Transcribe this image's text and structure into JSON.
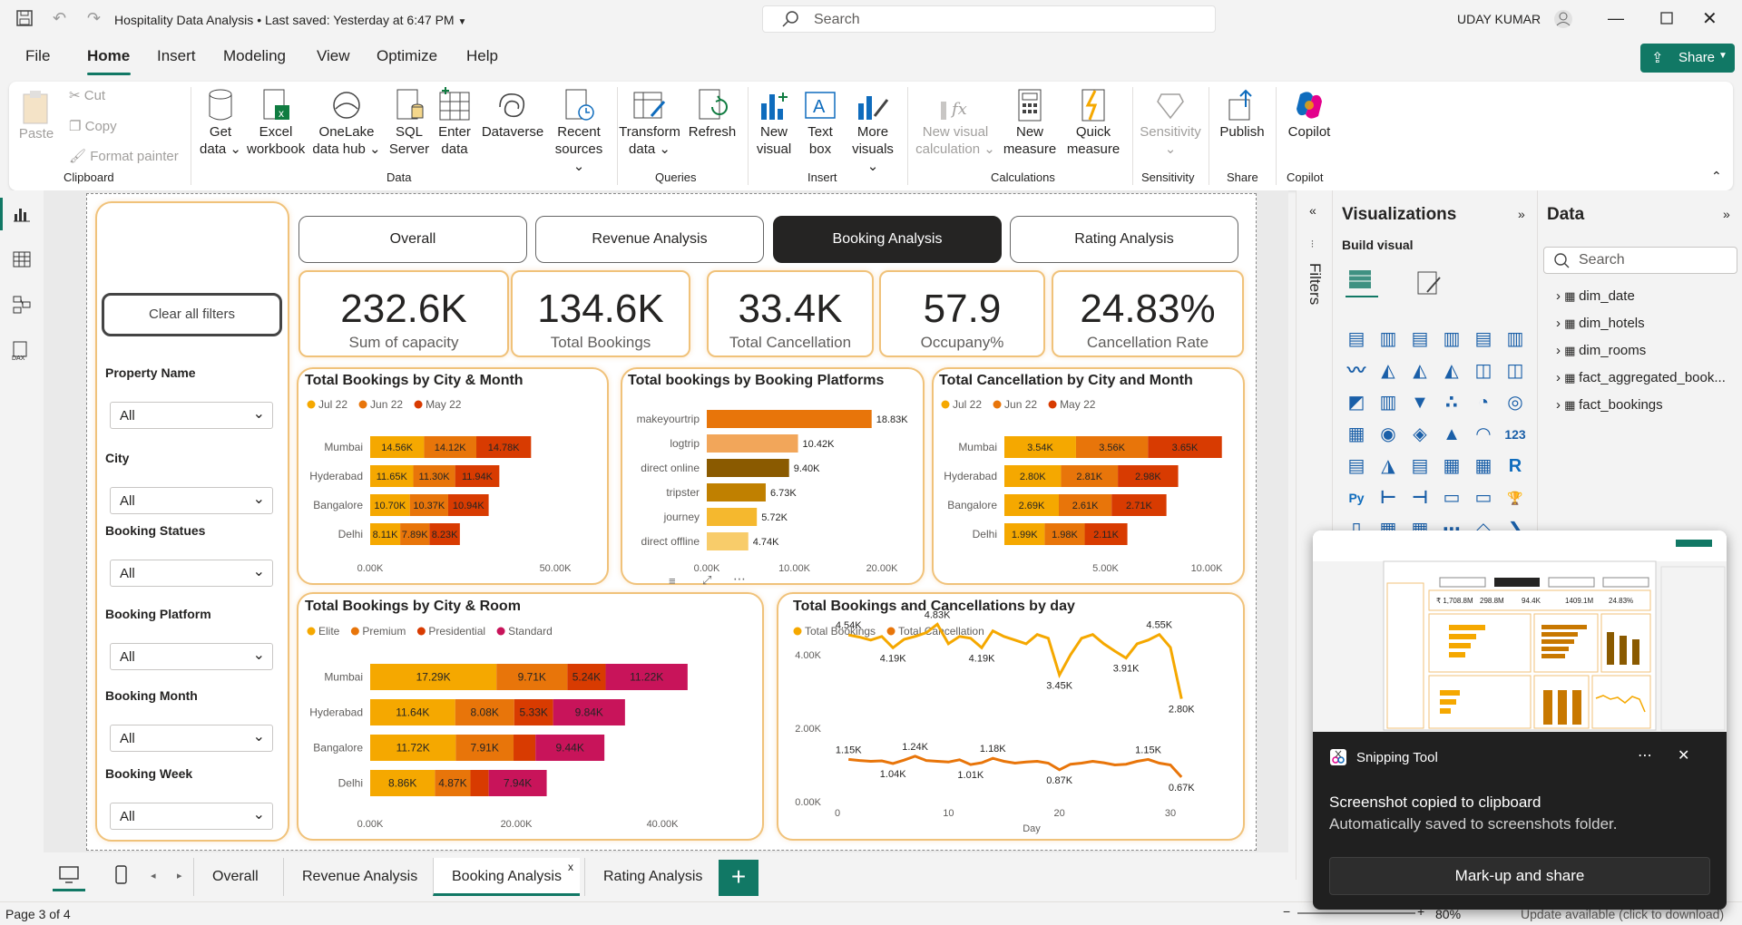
{
  "window": {
    "title": "Hospitality Data Analysis",
    "saved": "Last saved: Yesterday at 6:47 PM",
    "search_placeholder": "Search",
    "user": "UDAY KUMAR"
  },
  "menu": [
    "File",
    "Home",
    "Insert",
    "Modeling",
    "View",
    "Optimize",
    "Help"
  ],
  "share_label": "Share",
  "ribbon": {
    "clipboard": {
      "paste": "Paste",
      "cut": "Cut",
      "copy": "Copy",
      "format_painter": "Format painter",
      "group": "Clipboard"
    },
    "data": {
      "get_data": [
        "Get",
        "data"
      ],
      "excel": [
        "Excel",
        "workbook"
      ],
      "onelake": [
        "OneLake",
        "data hub"
      ],
      "sql": [
        "SQL",
        "Server"
      ],
      "enter": [
        "Enter",
        "data"
      ],
      "dataverse": "Dataverse",
      "recent": [
        "Recent",
        "sources"
      ],
      "group": "Data"
    },
    "queries": {
      "transform": [
        "Transform",
        "data"
      ],
      "refresh": "Refresh",
      "group": "Queries"
    },
    "insert": {
      "new_visual": [
        "New",
        "visual"
      ],
      "text_box": [
        "Text",
        "box"
      ],
      "more_visuals": [
        "More",
        "visuals"
      ],
      "group": "Insert"
    },
    "calculations": {
      "new_visual_calc": [
        "New visual",
        "calculation"
      ],
      "new_measure": [
        "New",
        "measure"
      ],
      "quick_measure": [
        "Quick",
        "measure"
      ],
      "group": "Calculations"
    },
    "sensitivity": {
      "label": "Sensitivity",
      "group": "Sensitivity"
    },
    "share": {
      "publish": "Publish",
      "group": "Share"
    },
    "copilot": {
      "label": "Copilot",
      "group": "Copilot"
    }
  },
  "report": {
    "nav": [
      "Overall",
      "Revenue Analysis",
      "Booking Analysis",
      "Rating Analysis"
    ],
    "clear_filters": "Clear all filters",
    "filters": [
      {
        "label": "Property Name",
        "value": "All"
      },
      {
        "label": "City",
        "value": "All"
      },
      {
        "label": "Booking Statues",
        "value": "All"
      },
      {
        "label": "Booking Platform",
        "value": "All"
      },
      {
        "label": "Booking Month",
        "value": "All"
      },
      {
        "label": "Booking Week",
        "value": "All"
      }
    ],
    "kpis": [
      {
        "value": "232.6K",
        "label": "Sum of capacity"
      },
      {
        "value": "134.6K",
        "label": "Total Bookings"
      },
      {
        "value": "33.4K",
        "label": "Total Cancellation"
      },
      {
        "value": "57.9",
        "label": "Occupany%"
      },
      {
        "value": "24.83%",
        "label": "Cancellation Rate"
      }
    ]
  },
  "chart_data": [
    {
      "type": "bar",
      "title": "Total Bookings by City & Month",
      "categories": [
        "Mumbai",
        "Hyderabad",
        "Bangalore",
        "Delhi"
      ],
      "series": [
        {
          "name": "Jul 22",
          "values": [
            14560,
            11650,
            10700,
            8110
          ],
          "labels": [
            "14.56K",
            "11.65K",
            "10.70K",
            "8.11K"
          ]
        },
        {
          "name": "Jun 22",
          "values": [
            14120,
            11300,
            10370,
            7890
          ],
          "labels": [
            "14.12K",
            "11.30K",
            "10.37K",
            "7.89K"
          ]
        },
        {
          "name": "May 22",
          "values": [
            14780,
            11940,
            10940,
            8230
          ],
          "labels": [
            "14.78K",
            "11.94K",
            "10.94K",
            "8.23K"
          ]
        }
      ],
      "xticks": [
        "0.00K",
        "50.00K"
      ],
      "xlim": [
        0,
        60000
      ]
    },
    {
      "type": "bar",
      "title": "Total bookings by Booking Platforms",
      "categories": [
        "makeyourtrip",
        "logtrip",
        "direct online",
        "tripster",
        "journey",
        "direct offline"
      ],
      "values": [
        18830,
        10420,
        9400,
        6730,
        5720,
        4740
      ],
      "labels": [
        "18.83K",
        "10.42K",
        "9.40K",
        "6.73K",
        "5.72K",
        "4.74K"
      ],
      "xticks": [
        "0.00K",
        "10.00K",
        "20.00K"
      ],
      "xlim": [
        0,
        20000
      ]
    },
    {
      "type": "bar",
      "title": "Total Cancellation by City and Month",
      "categories": [
        "Mumbai",
        "Hyderabad",
        "Bangalore",
        "Delhi"
      ],
      "series": [
        {
          "name": "Jul 22",
          "values": [
            3540,
            2800,
            2690,
            1990
          ],
          "labels": [
            "3.54K",
            "2.80K",
            "2.69K",
            "1.99K"
          ]
        },
        {
          "name": "Jun 22",
          "values": [
            3560,
            2810,
            2610,
            1980
          ],
          "labels": [
            "3.56K",
            "2.81K",
            "2.61K",
            "1.98K"
          ]
        },
        {
          "name": "May 22",
          "values": [
            3650,
            2980,
            2710,
            2110
          ],
          "labels": [
            "3.65K",
            "2.98K",
            "2.71K",
            "2.11K"
          ]
        }
      ],
      "xticks": [
        "5.00K",
        "10.00K"
      ],
      "xlim": [
        0,
        11000
      ]
    },
    {
      "type": "bar",
      "title": "Total Bookings by City & Room",
      "categories": [
        "Mumbai",
        "Hyderabad",
        "Bangalore",
        "Delhi"
      ],
      "series": [
        {
          "name": "Elite",
          "values": [
            17290,
            11640,
            11720,
            8860
          ],
          "labels": [
            "17.29K",
            "11.64K",
            "11.72K",
            "8.86K"
          ]
        },
        {
          "name": "Premium",
          "values": [
            9710,
            8080,
            7910,
            4870
          ],
          "labels": [
            "9.71K",
            "8.08K",
            "7.91K",
            "4.87K"
          ]
        },
        {
          "name": "Presidential",
          "values": [
            5240,
            5330,
            3000,
            2500
          ],
          "labels": [
            "5.24K",
            "5.33K",
            "",
            ""
          ]
        },
        {
          "name": "Standard",
          "values": [
            11220,
            9840,
            9440,
            7940
          ],
          "labels": [
            "11.22K",
            "9.84K",
            "9.44K",
            "7.94K"
          ]
        }
      ],
      "xticks": [
        "0.00K",
        "20.00K",
        "40.00K"
      ],
      "xlim": [
        0,
        45000
      ]
    },
    {
      "type": "line",
      "title": "Total Bookings and Cancellations by day",
      "xlabel": "Day",
      "xticks": [
        "0",
        "10",
        "20",
        "30"
      ],
      "yticks": [
        "0.00K",
        "2.00K",
        "4.00K"
      ],
      "xlim": [
        0,
        32
      ],
      "ylim": [
        0,
        5000
      ],
      "x": [
        1,
        2,
        3,
        4,
        5,
        6,
        7,
        8,
        9,
        10,
        11,
        12,
        13,
        14,
        15,
        16,
        17,
        18,
        19,
        20,
        21,
        22,
        23,
        24,
        25,
        26,
        27,
        28,
        29,
        30,
        31
      ],
      "series": [
        {
          "name": "Total Bookings",
          "values": [
            4540,
            4480,
            4400,
            4500,
            4190,
            4420,
            4500,
            4600,
            4830,
            4300,
            4500,
            4450,
            4190,
            4650,
            4500,
            4400,
            4300,
            4550,
            4450,
            3450,
            4000,
            4450,
            4550,
            4300,
            4100,
            3910,
            4300,
            4400,
            4550,
            4200,
            2800
          ]
        },
        {
          "name": "Total Cancellation",
          "values": [
            1150,
            1120,
            1100,
            1110,
            1040,
            1130,
            1240,
            1120,
            1100,
            1080,
            1140,
            1010,
            1060,
            1180,
            1100,
            1050,
            1080,
            1100,
            1050,
            870,
            1020,
            1050,
            1100,
            1060,
            1000,
            1020,
            1100,
            1150,
            1050,
            1000,
            670
          ]
        }
      ],
      "data_labels": [
        {
          "i": 0,
          "s": 0,
          "t": "4.54K"
        },
        {
          "i": 4,
          "s": 0,
          "t": "4.19K"
        },
        {
          "i": 8,
          "s": 0,
          "t": "4.83K"
        },
        {
          "i": 12,
          "s": 0,
          "t": "4.19K"
        },
        {
          "i": 19,
          "s": 0,
          "t": "3.45K"
        },
        {
          "i": 25,
          "s": 0,
          "t": "3.91K"
        },
        {
          "i": 28,
          "s": 0,
          "t": "4.55K"
        },
        {
          "i": 30,
          "s": 0,
          "t": "2.80K"
        },
        {
          "i": 0,
          "s": 1,
          "t": "1.15K"
        },
        {
          "i": 4,
          "s": 1,
          "t": "1.04K"
        },
        {
          "i": 6,
          "s": 1,
          "t": "1.24K"
        },
        {
          "i": 11,
          "s": 1,
          "t": "1.01K"
        },
        {
          "i": 13,
          "s": 1,
          "t": "1.18K"
        },
        {
          "i": 19,
          "s": 1,
          "t": "0.87K"
        },
        {
          "i": 27,
          "s": 1,
          "t": "1.15K"
        },
        {
          "i": 30,
          "s": 1,
          "t": "0.67K"
        }
      ]
    }
  ],
  "colors": {
    "jul": "#f5a800",
    "jun": "#e8750a",
    "may": "#d83b01",
    "standard": "#c8145a",
    "accent": "#117865"
  },
  "visualizations": {
    "title": "Visualizations",
    "build": "Build visual"
  },
  "data_pane": {
    "title": "Data",
    "search": "Search",
    "items": [
      "dim_date",
      "dim_hotels",
      "dim_rooms",
      "fact_aggregated_book...",
      "fact_bookings"
    ]
  },
  "filters_pane": "Filters",
  "tabs": [
    "Overall",
    "Revenue Analysis",
    "Booking Analysis",
    "Rating Analysis"
  ],
  "status": {
    "page": "Page 3 of 4",
    "zoom": "80%",
    "update": "Update available (click to download)"
  },
  "snipping": {
    "app": "Snipping Tool",
    "line1": "Screenshot copied to clipboard",
    "line2": "Automatically saved to screenshots folder.",
    "button": "Mark-up and share",
    "thumb_kpis": [
      "₹ 1,708.8M",
      "298.8M",
      "94.4K",
      "1409.1M",
      "24.83%"
    ]
  }
}
